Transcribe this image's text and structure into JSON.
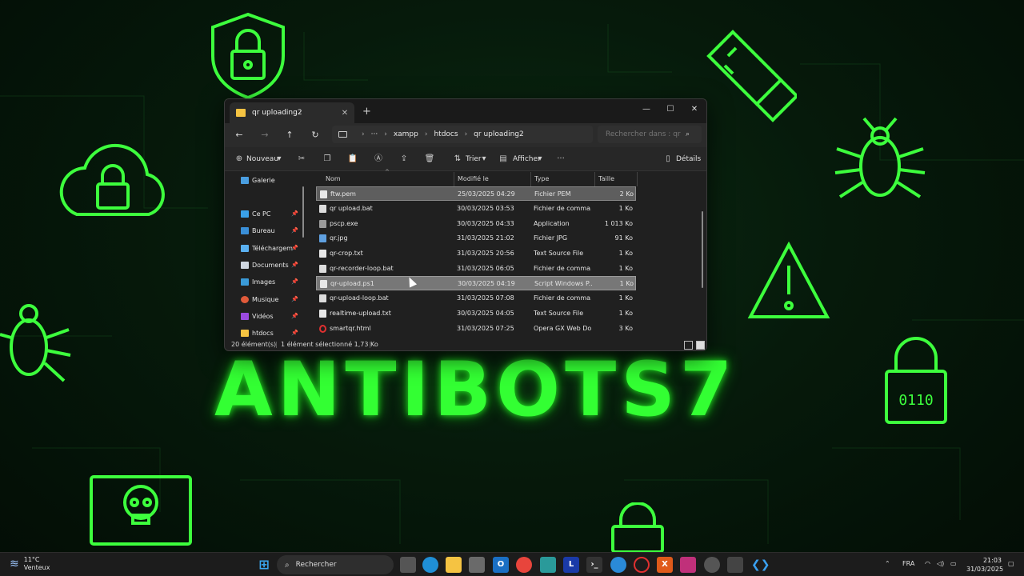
{
  "wallpaper": {
    "title": "ANTIBOTS7",
    "accent": "#33ff33",
    "lock_code": "0110"
  },
  "window": {
    "tab_title": "qr uploading2",
    "breadcrumbs": [
      "xampp",
      "htdocs",
      "qr uploading2"
    ],
    "search_placeholder": "Rechercher dans : qr u",
    "toolbar": {
      "new_label": "Nouveau",
      "sort_label": "Trier",
      "view_label": "Afficher",
      "details_label": "Détails"
    },
    "sidebar": [
      {
        "label": "Galerie",
        "icon": "gallery-icon",
        "color": "#4a9ee0"
      },
      {
        "label": "Ce PC",
        "icon": "pc-icon",
        "color": "#3aa0e8"
      },
      {
        "label": "Bureau",
        "icon": "desktop-icon",
        "color": "#3a8fd8"
      },
      {
        "label": "Téléchargem",
        "icon": "download-icon",
        "color": "#5ab0f0"
      },
      {
        "label": "Documents",
        "icon": "documents-icon",
        "color": "#cfd6e0"
      },
      {
        "label": "Images",
        "icon": "images-icon",
        "color": "#3a9ad8"
      },
      {
        "label": "Musique",
        "icon": "music-icon",
        "color": "#e05a3a"
      },
      {
        "label": "Vidéos",
        "icon": "videos-icon",
        "color": "#9a4ae0"
      },
      {
        "label": "htdocs",
        "icon": "folder-icon",
        "color": "#f5c342"
      }
    ],
    "columns": {
      "name": "Nom",
      "modified": "Modifié le",
      "type": "Type",
      "size": "Taille"
    },
    "files": [
      {
        "name": "ftw.pem",
        "modified": "25/03/2025 04:29",
        "type": "Fichier PEM",
        "size": "2 Ko",
        "icon": "file-icon"
      },
      {
        "name": "qr upload.bat",
        "modified": "30/03/2025 03:53",
        "type": "Fichier de comma...",
        "size": "1 Ko",
        "icon": "bat-icon"
      },
      {
        "name": "pscp.exe",
        "modified": "30/03/2025 04:33",
        "type": "Application",
        "size": "1 013 Ko",
        "icon": "app-icon"
      },
      {
        "name": "qr.jpg",
        "modified": "31/03/2025 21:02",
        "type": "Fichier JPG",
        "size": "91 Ko",
        "icon": "image-file-icon"
      },
      {
        "name": "qr-crop.txt",
        "modified": "31/03/2025 20:56",
        "type": "Text Source File",
        "size": "1 Ko",
        "icon": "file-icon"
      },
      {
        "name": "qr-recorder-loop.bat",
        "modified": "31/03/2025 06:05",
        "type": "Fichier de comma...",
        "size": "1 Ko",
        "icon": "bat-icon"
      },
      {
        "name": "qr-upload.ps1",
        "modified": "30/03/2025 04:19",
        "type": "Script Windows P...",
        "size": "1 Ko",
        "icon": "script-icon"
      },
      {
        "name": "qr-upload-loop.bat",
        "modified": "31/03/2025 07:08",
        "type": "Fichier de comma...",
        "size": "1 Ko",
        "icon": "bat-icon"
      },
      {
        "name": "realtime-upload.txt",
        "modified": "30/03/2025 04:05",
        "type": "Text Source File",
        "size": "1 Ko",
        "icon": "file-icon"
      },
      {
        "name": "smartqr.html",
        "modified": "31/03/2025 07:25",
        "type": "Opera GX Web Do...",
        "size": "3 Ko",
        "icon": "opera-icon"
      }
    ],
    "status": {
      "count": "20 élément(s)",
      "selection": "1 élément sélectionné 1,73 Ko"
    }
  },
  "taskbar": {
    "weather_temp": "11°C",
    "weather_desc": "Venteux",
    "search_label": "Rechercher",
    "lang": "FRA",
    "time": "21:03",
    "date": "31/03/2025"
  }
}
